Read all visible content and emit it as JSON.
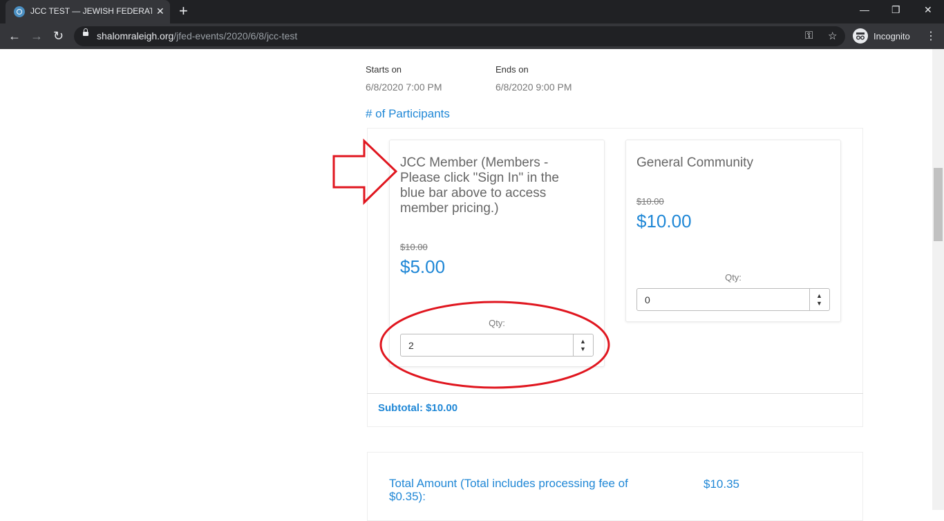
{
  "browser": {
    "tab_title": "JCC TEST — JEWISH FEDERATION",
    "tab_close": "✕",
    "new_tab": "+",
    "url_host": "shalomraleigh.org",
    "url_path": "/jfed-events/2020/6/8/jcc-test",
    "incognito_label": "Incognito",
    "controls": {
      "minimize": "—",
      "restore": "❐",
      "close": "✕"
    },
    "nav": {
      "back": "←",
      "forward": "→",
      "reload": "↻",
      "menu": "⋮",
      "key": "⚿",
      "star": "☆"
    }
  },
  "event": {
    "starts_label": "Starts on",
    "starts_value": "6/8/2020 7:00 PM",
    "ends_label": "Ends on",
    "ends_value": "6/8/2020 9:00 PM"
  },
  "participants": {
    "section_title": "# of Participants",
    "tickets": [
      {
        "title": "JCC Member (Members - Please click \"Sign In\" in the blue bar above to access member pricing.)",
        "original_price": "$10.00",
        "price": "$5.00",
        "qty_label": "Qty:",
        "qty_value": "2"
      },
      {
        "title": "General Community",
        "original_price": "$10.00",
        "price": "$10.00",
        "qty_label": "Qty:",
        "qty_value": "0"
      }
    ],
    "subtotal": "Subtotal: $10.00"
  },
  "total": {
    "label": "Total Amount (Total includes processing fee of $0.35):",
    "value": "$10.35"
  },
  "colors": {
    "accent": "#1f87d6",
    "annotation": "#e0161f"
  },
  "icons": [
    "favicon-icon",
    "close-icon",
    "plus-icon",
    "back-icon",
    "forward-icon",
    "reload-icon",
    "lock-icon",
    "key-icon",
    "star-icon",
    "incognito-icon",
    "menu-icon",
    "spinner-up-icon",
    "spinner-down-icon",
    "arrow-annotation-icon"
  ]
}
